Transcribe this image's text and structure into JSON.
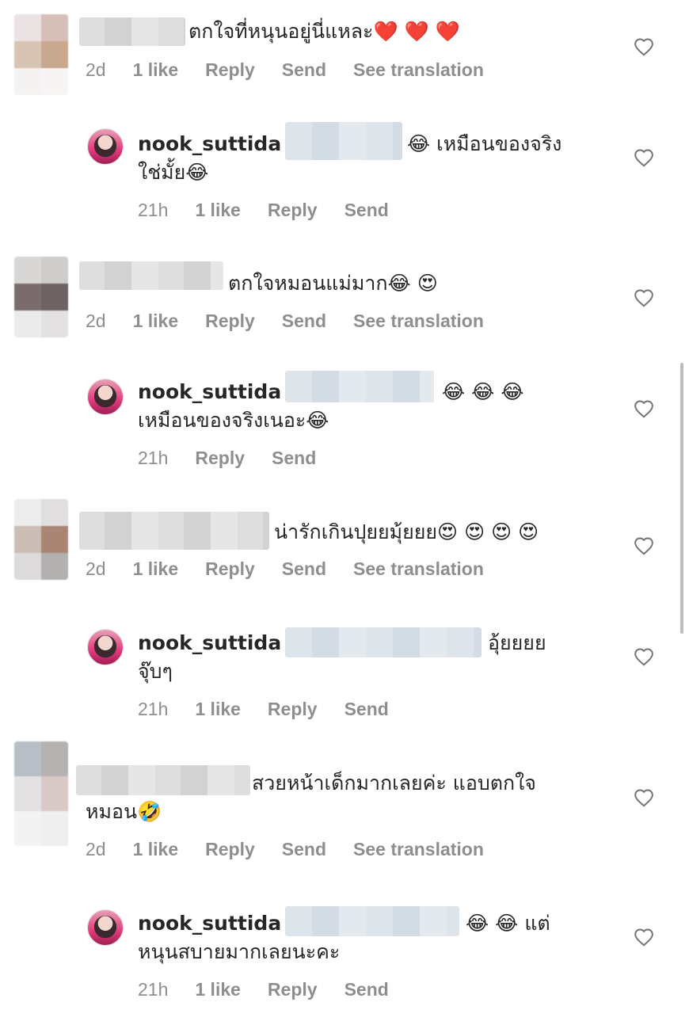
{
  "comments": [
    {
      "text_line1": "ตกใจที่หนุนอยู่นี่แหละ❤️ ❤️ ❤️",
      "text_line2": "",
      "age": "2d",
      "likes": "1 like",
      "reply": "Reply",
      "send": "Send",
      "translate": "See translation",
      "avatar_colors": [
        "#ebe3e3",
        "#d6bfb9",
        "#d8c4b3",
        "#c9a890",
        "#f5f3f2",
        "#f7f5f4"
      ]
    },
    {
      "username": "nook_suttida",
      "text_line1": "😂 เหมือนของจริง",
      "text_line2": "ใช่มั้ย😂",
      "age": "21h",
      "likes": "1 like",
      "reply": "Reply",
      "send": "Send"
    },
    {
      "text_line1": "ตกใจหมอนแม่มาก😂 😍",
      "text_line2": "",
      "age": "2d",
      "likes": "1 like",
      "reply": "Reply",
      "send": "Send",
      "translate": "See translation",
      "avatar_colors": [
        "#d9d6d6",
        "#cfcccc",
        "#7a6c6c",
        "#6f6262",
        "#ecebeb",
        "#e3e1e1"
      ]
    },
    {
      "username": "nook_suttida",
      "text_line1": "😂 😂 😂",
      "text_line2": "เหมือนของจริงเนอะ😂",
      "age": "21h",
      "likes": "",
      "reply": "Reply",
      "send": "Send"
    },
    {
      "text_line1": "น่ารักเกินปุยยมุ้ยยย😍 😍 😍 😍",
      "text_line2": "",
      "age": "2d",
      "likes": "1 like",
      "reply": "Reply",
      "send": "Send",
      "translate": "See translation",
      "avatar_colors": [
        "#ececec",
        "#e0dede",
        "#cbbdb6",
        "#a98573",
        "#dcdada",
        "#b3b0b0"
      ]
    },
    {
      "username": "nook_suttida",
      "text_line1": "อุ้ยยยย",
      "text_line2": "จุ๊บๆ",
      "age": "21h",
      "likes": "1 like",
      "reply": "Reply",
      "send": "Send"
    },
    {
      "text_line1": "สวยหน้าเด็กมากเลยค่ะ แอบตกใจ",
      "text_line2": "หมอน🤣",
      "age": "2d",
      "likes": "1 like",
      "reply": "Reply",
      "send": "Send",
      "translate": "See translation",
      "avatar_colors": [
        "#b8bec6",
        "#b7b2b2",
        "#e3e1e1",
        "#d8c8c6",
        "#f3f3f3",
        "#efefef"
      ]
    },
    {
      "username": "nook_suttida",
      "text_line1": "😂 😂 แต่",
      "text_line2": "หนุนสบายมากเลยนะคะ",
      "age": "21h",
      "likes": "1 like",
      "reply": "Reply",
      "send": "Send"
    }
  ]
}
